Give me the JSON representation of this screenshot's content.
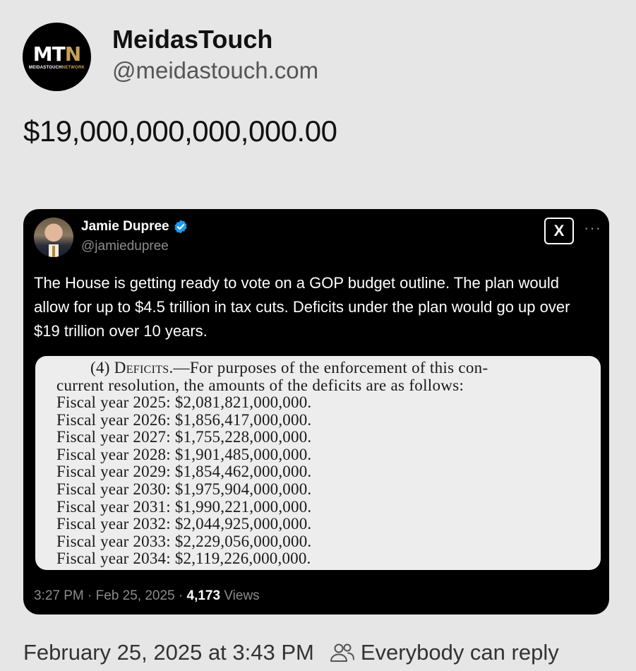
{
  "post": {
    "avatar": {
      "letters_white": "MT",
      "letters_gold": "N",
      "sub_white": "MEIDASTOUCH",
      "sub_gold": "NETWORK"
    },
    "display_name": "MeidasTouch",
    "handle": "@meidastouch.com",
    "text": "$19,000,000,000,000.00"
  },
  "embed": {
    "author": {
      "name": "Jamie Dupree",
      "handle": "@jamiedupree",
      "verified_icon": "verified-badge-icon",
      "verified_color": "#1d9bf0"
    },
    "x_logo": "X",
    "more": "···",
    "text": "The House is getting ready to vote on a GOP budget outline.  The plan would allow for up to $4.5 trillion in tax cuts.  Deficits under the plan would go up over $19 trillion over 10 years.",
    "document": {
      "heading_num": "(4)",
      "heading_title": "Deficits",
      "heading_rest": ".—For purposes of the enforcement of this con-",
      "heading_line2": "current resolution, the amounts of the deficits are as follows:",
      "rows": [
        {
          "label": "Fiscal year 2025:",
          "amount": "$2,081,821,000,000."
        },
        {
          "label": "Fiscal year 2026:",
          "amount": "$1,856,417,000,000."
        },
        {
          "label": "Fiscal year 2027:",
          "amount": "$1,755,228,000,000."
        },
        {
          "label": "Fiscal year 2028:",
          "amount": "$1,901,485,000,000."
        },
        {
          "label": "Fiscal year 2029:",
          "amount": "$1,854,462,000,000."
        },
        {
          "label": "Fiscal year 2030:",
          "amount": "$1,975,904,000,000."
        },
        {
          "label": "Fiscal year 2031:",
          "amount": "$1,990,221,000,000."
        },
        {
          "label": "Fiscal year 2032:",
          "amount": "$2,044,925,000,000."
        },
        {
          "label": "Fiscal year 2033:",
          "amount": "$2,229,056,000,000."
        },
        {
          "label": "Fiscal year 2034:",
          "amount": "$2,119,226,000,000."
        }
      ]
    },
    "meta": {
      "time_date": "3:27 PM · Feb 25, 2025 · ",
      "views_count": "4,173",
      "views_label": " Views"
    }
  },
  "footer": {
    "timestamp": "February 25, 2025 at 3:43 PM",
    "reply_icon": "people-icon",
    "reply_setting": "Everybody can reply"
  }
}
